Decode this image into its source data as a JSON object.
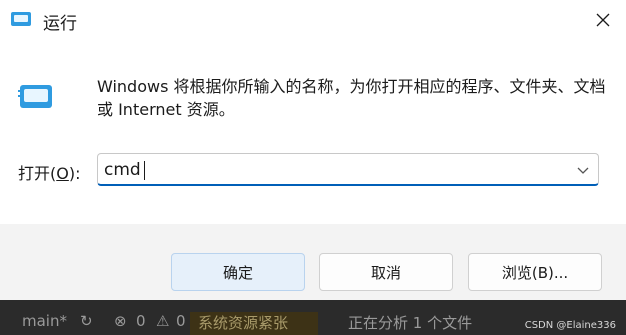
{
  "window": {
    "title": "运行",
    "icon": "run-dialog-icon",
    "close_icon": "close-icon"
  },
  "description": "Windows 将根据你所输入的名称，为你打开相应的程序、文件夹、文档或 Internet 资源。",
  "open_field": {
    "label_prefix": "打开(",
    "label_accel": "O",
    "label_suffix": "):",
    "value": "cmd"
  },
  "buttons": {
    "ok": "确定",
    "cancel": "取消",
    "browse": "浏览(B)..."
  },
  "taskbar": {
    "branch": "main*",
    "errors": "0",
    "warnings": "0",
    "explorer_tab": "系统资源紧张",
    "status": "正在分析 1 个文件"
  },
  "watermark": "CSDN @Elaine336",
  "colors": {
    "focus_underline": "#005fb8",
    "primary_button_bg": "#e6f0fa"
  }
}
